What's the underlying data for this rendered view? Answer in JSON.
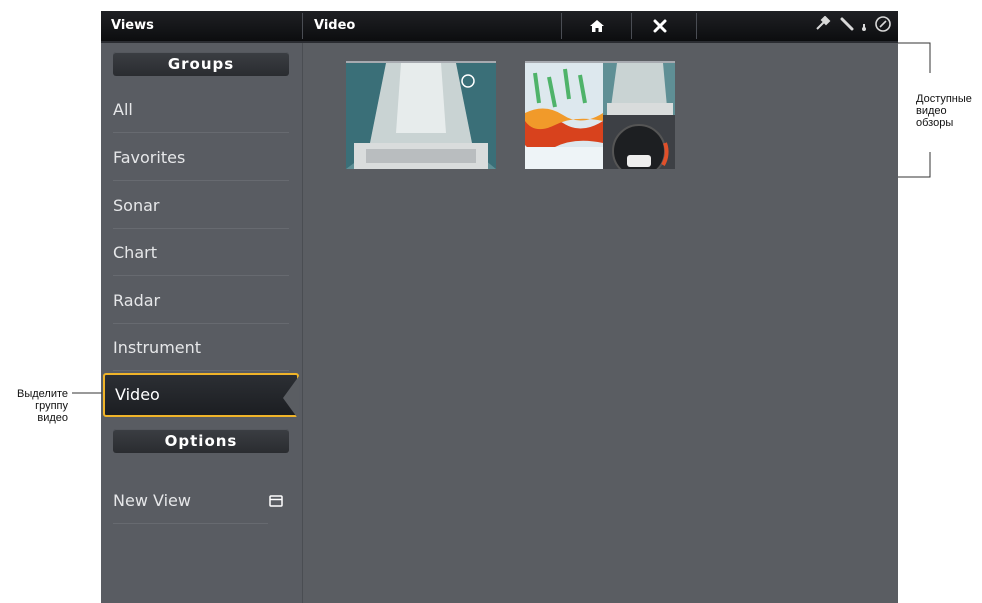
{
  "topbar": {
    "views_title": "Views",
    "video_title": "Video",
    "buttons": [
      "home-icon",
      "close-icon"
    ],
    "status_icons": [
      "gps-icon",
      "satellite-icon",
      "temperature-icon",
      "compass-icon"
    ]
  },
  "sidebar": {
    "groups_header": "Groups",
    "items": [
      {
        "label": "All"
      },
      {
        "label": "Favorites"
      },
      {
        "label": "Sonar"
      },
      {
        "label": "Chart"
      },
      {
        "label": "Radar"
      },
      {
        "label": "Instrument"
      },
      {
        "label": "Video",
        "selected": true
      }
    ],
    "options_header": "Options",
    "new_view": "New View"
  },
  "thumbnails": [
    {
      "name": "video-view-full",
      "icon": "camera-feed"
    },
    {
      "name": "video-view-sonar-combo",
      "icon": "sonar-gauge-video"
    }
  ],
  "annotations": {
    "available": "Доступные видео обзоры",
    "available_lines": [
      "Доступные",
      "видео",
      "обзоры"
    ],
    "select_lines": [
      "Выделите",
      "группу",
      "видео"
    ]
  },
  "colors": {
    "accent": "#f0b429",
    "panel": "#5a5d62",
    "header_bar": "#1a1b1e"
  }
}
